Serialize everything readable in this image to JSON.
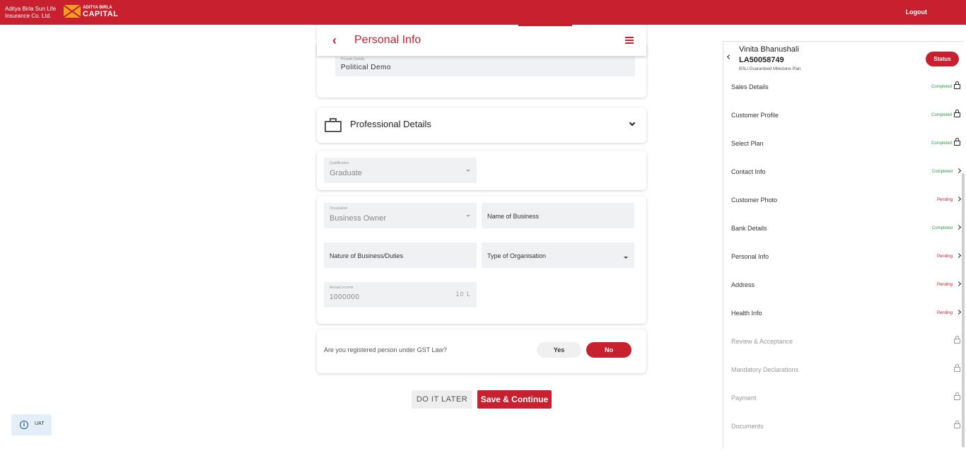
{
  "header": {
    "brand_line1": "Aditya Birla Sun Life",
    "brand_line2": "Insurance Co. Ltd.",
    "capital_small": "ADITYA BIRLA",
    "capital_big": "CAPITAL",
    "logout": "Logout"
  },
  "personal_info": {
    "title": "Personal Info",
    "provide_details_label": "Provide Details",
    "provide_details_value": "Political Demo"
  },
  "professional": {
    "title": "Professional Details",
    "qualification_label": "Qualification",
    "qualification_value": "Graduate",
    "occupation_label": "Occupation",
    "occupation_value": "Business Owner",
    "name_of_business_placeholder": "Name of Business",
    "nature_of_business_placeholder": "Nature of Business/Duties",
    "type_of_org_placeholder": "Type of Organisation",
    "annual_income_label": "Annual Income",
    "annual_income_value": "1000000",
    "annual_income_suffix": "10 L"
  },
  "gst": {
    "question": "Are you registered person under GST Law?",
    "yes": "Yes",
    "no": "No"
  },
  "actions": {
    "later": "DO IT LATER",
    "save": "Save & Continue"
  },
  "uat": {
    "label": "UAT"
  },
  "sidebar": {
    "name": "Vinita Bhanushali",
    "app_no": "LA50058749",
    "plan": "BSLI Guaranteed Milestone Plan",
    "status": "Status",
    "items": [
      {
        "label": "Sales Details",
        "state": "Completed",
        "icon": "lock"
      },
      {
        "label": "Customer Profile",
        "state": "Completed",
        "icon": "lock"
      },
      {
        "label": "Select Plan",
        "state": "Completed",
        "icon": "lock"
      },
      {
        "label": "Contact Info",
        "state": "Completed",
        "icon": "arrow"
      },
      {
        "label": "Customer Photo",
        "state": "Pending",
        "icon": "arrow"
      },
      {
        "label": "Bank Details",
        "state": "Completed",
        "icon": "arrow"
      },
      {
        "label": "Personal Info",
        "state": "Pending",
        "icon": "arrow"
      },
      {
        "label": "Address",
        "state": "Pending",
        "icon": "arrow"
      },
      {
        "label": "Health Info",
        "state": "Pending",
        "icon": "arrow"
      },
      {
        "label": "Review & Acceptance",
        "state": "",
        "icon": "lock-grey"
      },
      {
        "label": "Mandatory Declarations",
        "state": "",
        "icon": "lock-grey"
      },
      {
        "label": "Payment",
        "state": "",
        "icon": "lock-grey"
      },
      {
        "label": "Documents",
        "state": "",
        "icon": "lock-grey"
      }
    ]
  },
  "colors": {
    "brand_red": "#c8202f",
    "completed_green": "#2e9a4e"
  }
}
